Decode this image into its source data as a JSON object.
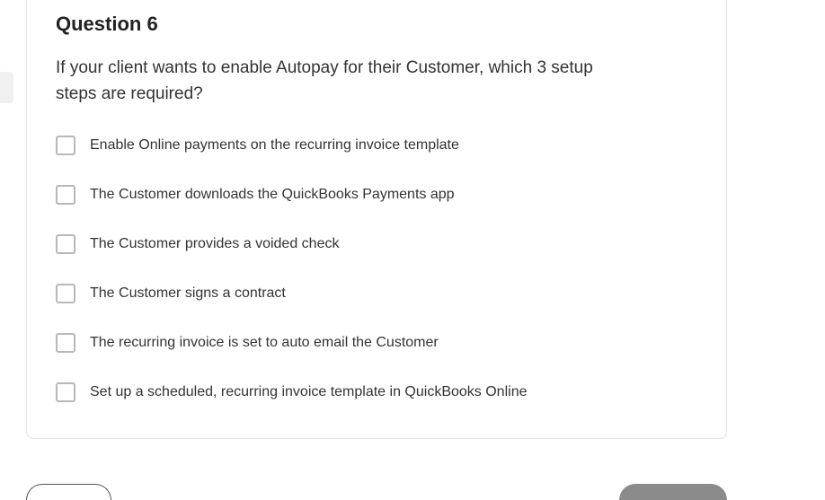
{
  "question": {
    "title": "Question 6",
    "text": "If your client wants to enable Autopay for their Customer, which 3 setup steps are required?",
    "options": [
      {
        "label": "Enable Online payments on the recurring invoice template"
      },
      {
        "label": "The Customer downloads the QuickBooks Payments app"
      },
      {
        "label": "The Customer provides a voided check"
      },
      {
        "label": "The Customer signs a contract"
      },
      {
        "label": "The recurring invoice is set to auto email the Customer"
      },
      {
        "label": "Set up a scheduled, recurring invoice template in QuickBooks Online"
      }
    ]
  }
}
